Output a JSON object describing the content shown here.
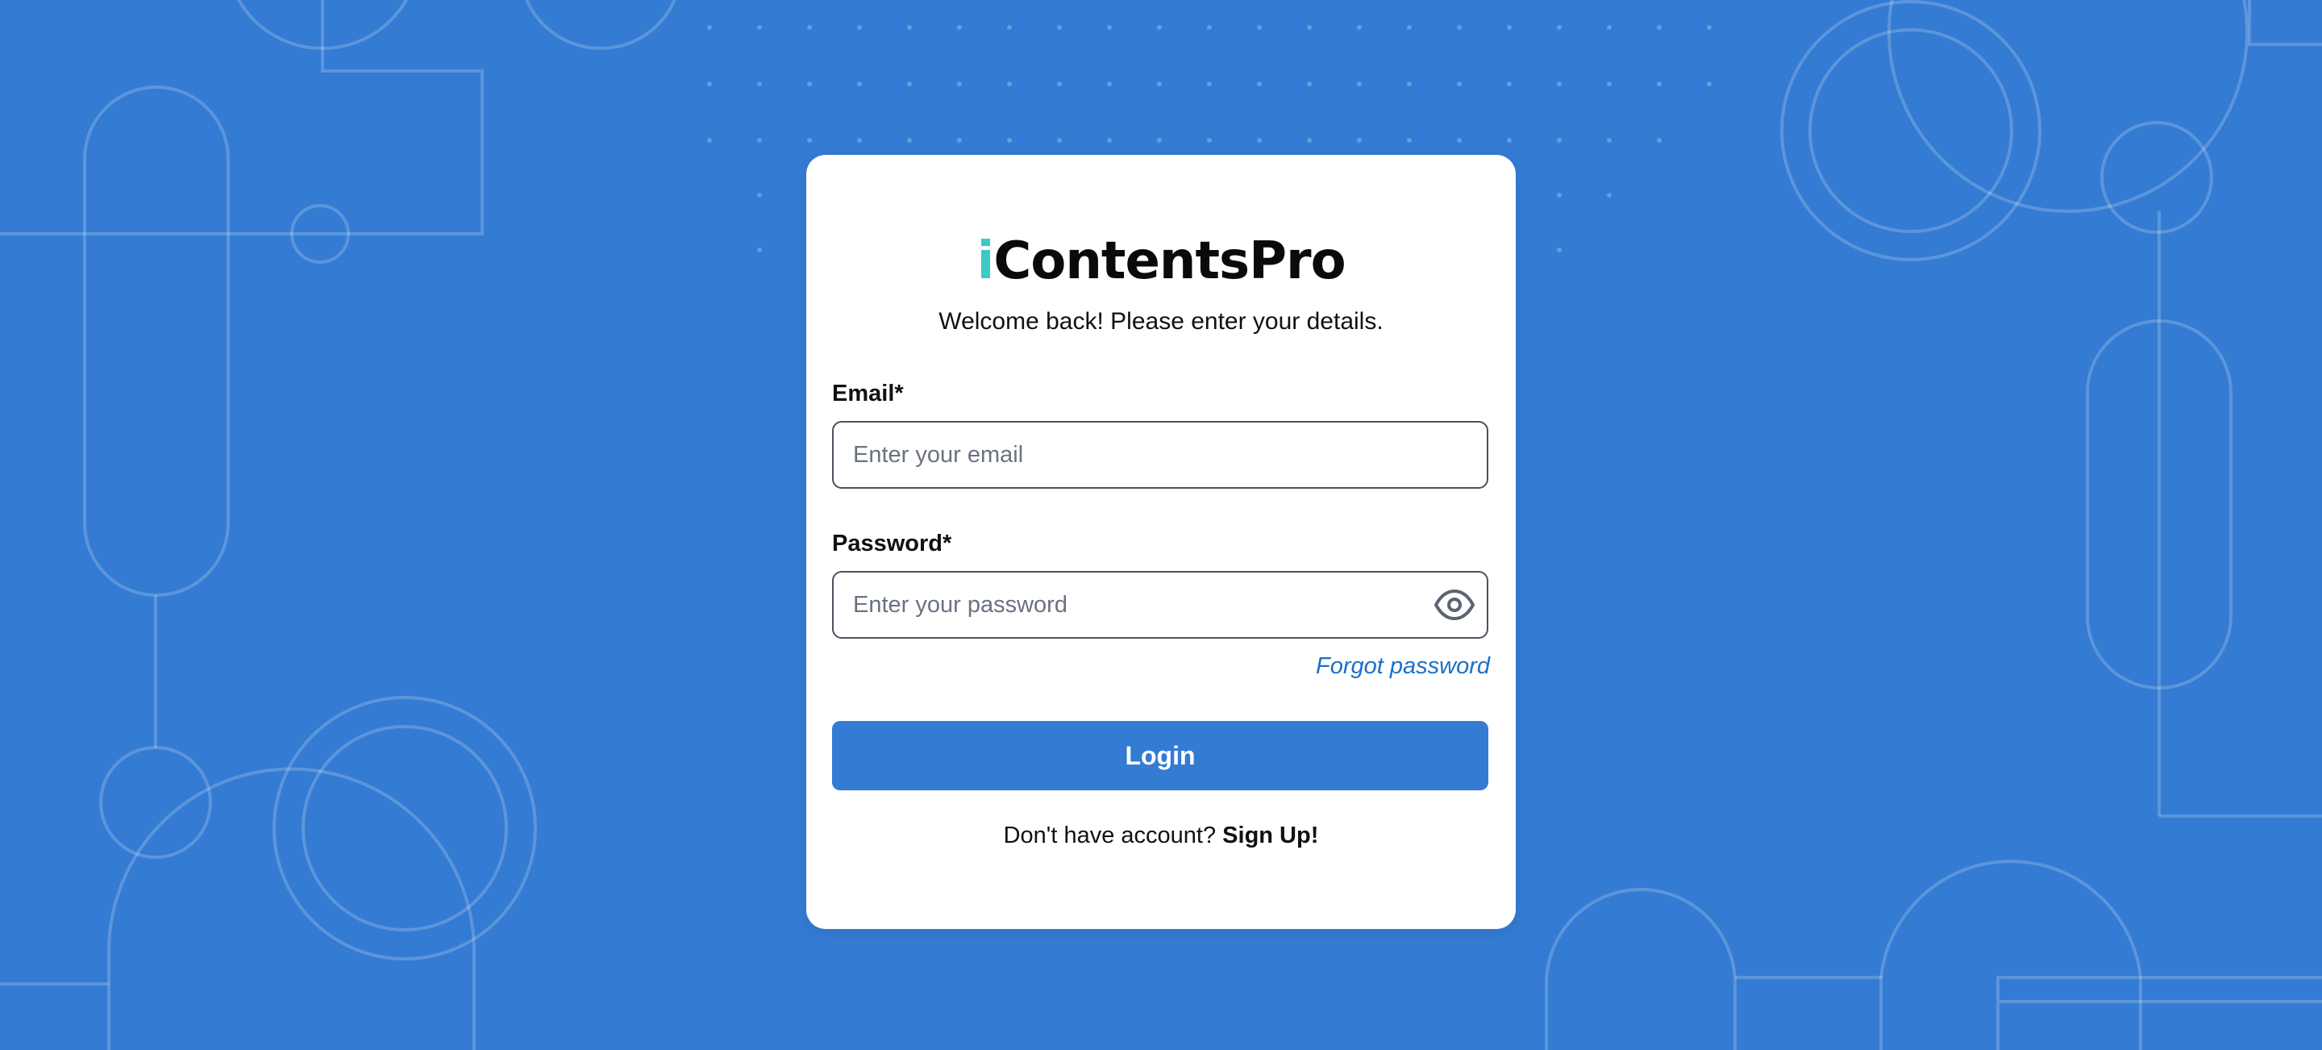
{
  "brand": {
    "logo_accent": "i",
    "logo_rest": "ContentsPro",
    "accent_color": "#3ec9c7"
  },
  "login": {
    "subtitle": "Welcome back! Please enter your details.",
    "email_label": "Email*",
    "email_placeholder": "Enter your email",
    "email_value": "",
    "password_label": "Password*",
    "password_placeholder": "Enter your password",
    "password_value": "",
    "password_toggle_icon": "eye-icon",
    "forgot_password": "Forgot password",
    "login_button": "Login",
    "signup_prompt": "Don't have account?",
    "signup_link": "Sign Up!"
  },
  "theme": {
    "background": "#347bd3",
    "card": "#ffffff",
    "link": "#1c6fc9"
  }
}
